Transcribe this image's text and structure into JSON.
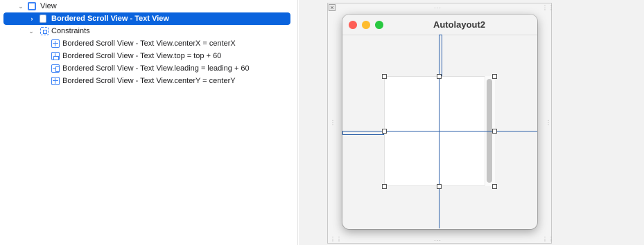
{
  "outline": {
    "root_label": "View",
    "selected_label": "Bordered Scroll View - Text View",
    "constraints_label": "Constraints",
    "constraints": [
      {
        "label": "Bordered Scroll View - Text View.centerX = centerX",
        "icon": "center-x-constraint-icon"
      },
      {
        "label": "Bordered Scroll View - Text View.top = top + 60",
        "icon": "top-constraint-icon"
      },
      {
        "label": "Bordered Scroll View - Text View.leading = leading + 60",
        "icon": "leading-constraint-icon"
      },
      {
        "label": "Bordered Scroll View - Text View.centerY = centerY",
        "icon": "center-y-constraint-icon"
      }
    ]
  },
  "canvas": {
    "window_title": "Autolayout2",
    "traffic_lights": {
      "close": "#fe5f57",
      "minimize": "#febc2e",
      "zoom": "#28c840"
    },
    "constraint_color": "#2b5fa8",
    "selection_color": "#0a63dd"
  }
}
